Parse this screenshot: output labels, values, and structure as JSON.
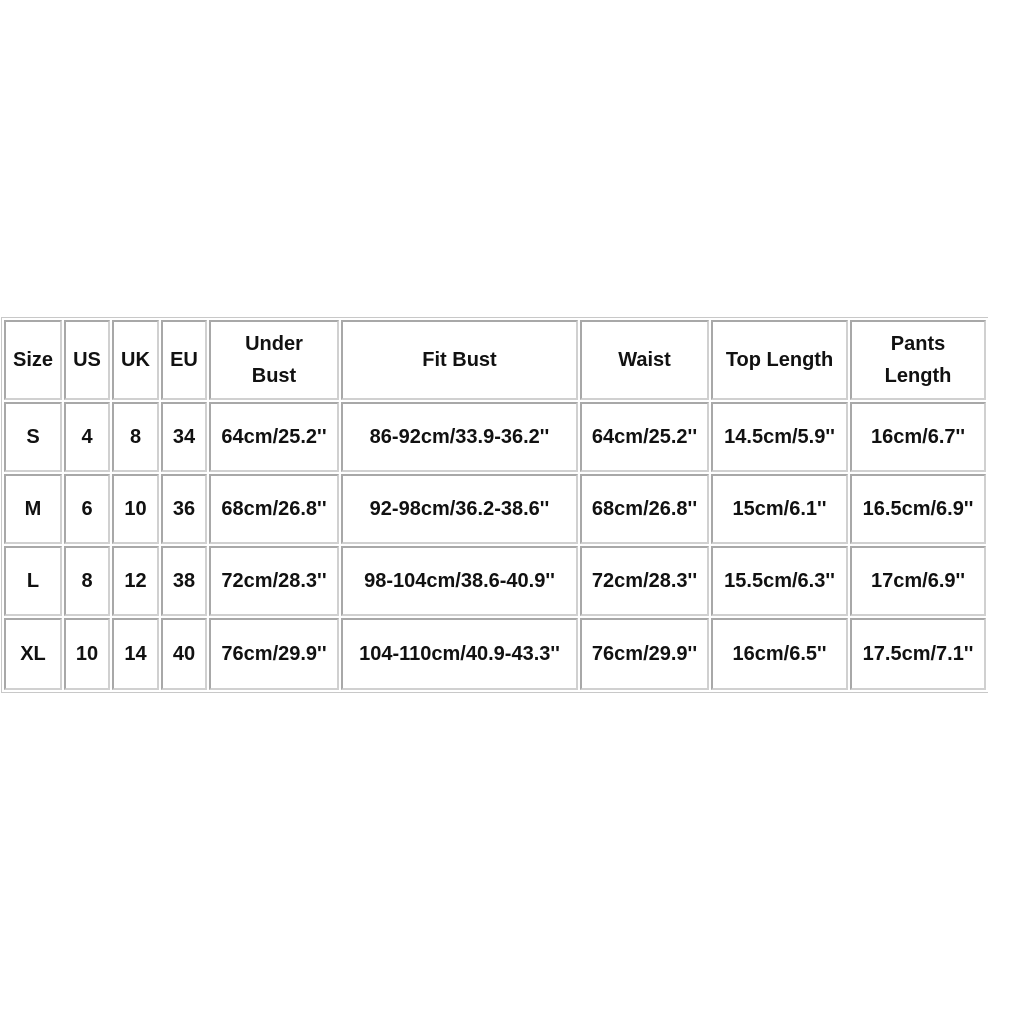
{
  "table": {
    "headers": [
      "Size",
      "US",
      "UK",
      "EU",
      "Under\nBust",
      "Fit Bust",
      "Waist",
      "Top Length",
      "Pants\nLength"
    ],
    "rows": [
      [
        "S",
        "4",
        "8",
        "34",
        "64cm/25.2''",
        "86-92cm/33.9-36.2''",
        "64cm/25.2''",
        "14.5cm/5.9''",
        "16cm/6.7''"
      ],
      [
        "M",
        "6",
        "10",
        "36",
        "68cm/26.8''",
        "92-98cm/36.2-38.6''",
        "68cm/26.8''",
        "15cm/6.1''",
        "16.5cm/6.9''"
      ],
      [
        "L",
        "8",
        "12",
        "38",
        "72cm/28.3''",
        "98-104cm/38.6-40.9''",
        "72cm/28.3''",
        "15.5cm/6.3''",
        "17cm/6.9''"
      ],
      [
        "XL",
        "10",
        "14",
        "40",
        "76cm/29.9''",
        "104-110cm/40.9-43.3''",
        "76cm/29.9''",
        "16cm/6.5''",
        "17.5cm/7.1''"
      ]
    ]
  }
}
